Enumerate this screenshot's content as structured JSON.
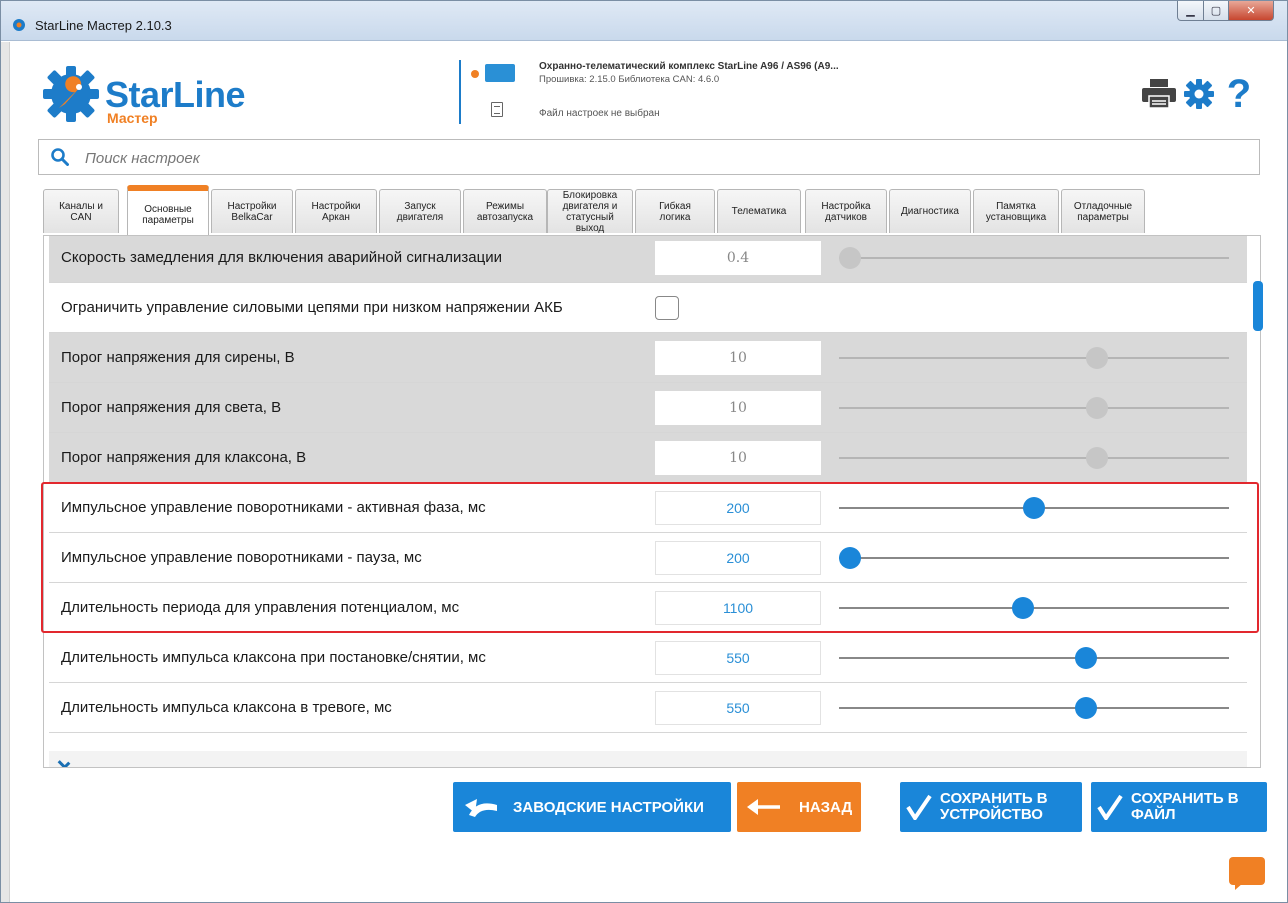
{
  "window": {
    "title": "StarLine Мастер 2.10.3",
    "min_symbol": "▁",
    "max_symbol": "▢",
    "close_symbol": "✕"
  },
  "logo": {
    "brand": "StarLine",
    "sub": "Мастер"
  },
  "device": {
    "name": "Охранно-телематический комплекс StarLine A96 / AS96 (A9...",
    "firmware": "Прошивка: 2.15.0   Библиотека CAN: 4.6.0",
    "file_status": "Файл настроек не выбран"
  },
  "tools": {
    "help_symbol": "?"
  },
  "search": {
    "placeholder": "Поиск настроек",
    "value": ""
  },
  "tabs": [
    {
      "label": "Каналы и\nCAN",
      "active": false
    },
    {
      "label": "Основные\nпараметры",
      "active": true
    },
    {
      "label": "Настройки\nBelkaCar",
      "active": false
    },
    {
      "label": "Настройки\nАркан",
      "active": false
    },
    {
      "label": "Запуск\nдвигателя",
      "active": false
    },
    {
      "label": "Режимы\nавтозапуска",
      "active": false
    },
    {
      "label": "Блокировка\nдвигателя и\nстатусный\nвыход",
      "active": false
    },
    {
      "label": "Гибкая\nлогика",
      "active": false
    },
    {
      "label": "Телематика",
      "active": false
    },
    {
      "label": "Настройка\nдатчиков",
      "active": false
    },
    {
      "label": "Диагностика",
      "active": false
    },
    {
      "label": "Памятка\nустановщика",
      "active": false
    },
    {
      "label": "Отладочные\nпараметры",
      "active": false
    }
  ],
  "settings": [
    {
      "label": "Скорость замедления для включения аварийной сигнализации",
      "value": "0.4",
      "disabled": true,
      "slider": 0.0
    },
    {
      "label": "Ограничить управление силовыми цепями при низком напряжении АКБ",
      "type": "checkbox",
      "checked": false
    },
    {
      "label": "Порог напряжения для сирены, В",
      "value": "10",
      "disabled": true,
      "slider": 0.67
    },
    {
      "label": "Порог напряжения для света, В",
      "value": "10",
      "disabled": true,
      "slider": 0.67
    },
    {
      "label": "Порог напряжения для клаксона, В",
      "value": "10",
      "disabled": true,
      "slider": 0.67
    },
    {
      "label": "Импульсное управление поворотниками - активная фаза, мс",
      "value": "200",
      "disabled": false,
      "slider": 0.5
    },
    {
      "label": "Импульсное управление поворотниками - пауза, мс",
      "value": "200",
      "disabled": false,
      "slider": 0.0
    },
    {
      "label": "Длительность периода для управления потенциалом, мс",
      "value": "1100",
      "disabled": false,
      "slider": 0.47
    },
    {
      "label": "Длительность импульса клаксона при постановке/снятии, мс",
      "value": "550",
      "disabled": false,
      "slider": 0.64
    },
    {
      "label": "Длительность импульса клаксона в тревоге, мс",
      "value": "550",
      "disabled": false,
      "slider": 0.64
    }
  ],
  "buttons": {
    "factory": "ЗАВОДСКИЕ НАСТРОЙКИ",
    "back": "НАЗАД",
    "save_device": "СОХРАНИТЬ В\nУСТРОЙСТВО",
    "save_file": "СОХРАНИТЬ В\nФАЙЛ"
  },
  "colors": {
    "accent_blue": "#1a86d9",
    "accent_orange": "#f08024",
    "highlight_red": "#e2282e"
  }
}
